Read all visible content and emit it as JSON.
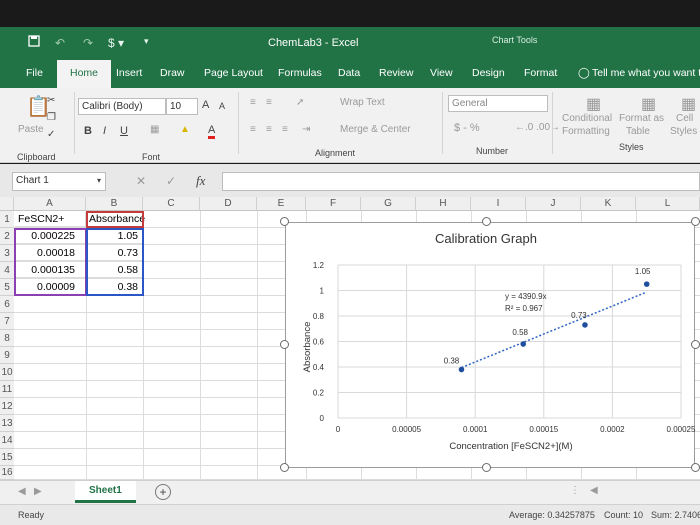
{
  "window": {
    "title": "ChemLab3 - Excel",
    "chart_tools": "Chart Tools"
  },
  "tabs": [
    "File",
    "Home",
    "Insert",
    "Draw",
    "Page Layout",
    "Formulas",
    "Data",
    "Review",
    "View",
    "Design",
    "Format"
  ],
  "active_tab": "Home",
  "tell_me": "Tell me what you want t",
  "ribbon": {
    "paste": "Paste",
    "clipboard": "Clipboard",
    "font_name": "Calibri (Body)",
    "font_size": "10",
    "font_group": "Font",
    "bold": "B",
    "italic": "I",
    "underline": "U",
    "wrap_text": "Wrap Text",
    "merge_center": "Merge & Center",
    "alignment_group": "Alignment",
    "number_format": "General",
    "number_symbols": "$ - %",
    "number_group": "Number",
    "conditional_1": "Conditional",
    "conditional_2": "Formatting",
    "format_as_1": "Format as",
    "format_as_2": "Table",
    "cell_1": "Cell",
    "cell_2": "Styles",
    "styles_group": "Styles"
  },
  "formula_bar": {
    "name_box": "Chart 1",
    "fx": "fx",
    "value": ""
  },
  "columns": [
    "A",
    "B",
    "C",
    "D",
    "E",
    "F",
    "G",
    "H",
    "I",
    "J",
    "K",
    "L"
  ],
  "rows": [
    "1",
    "2",
    "3",
    "4",
    "5",
    "6",
    "7",
    "8",
    "9",
    "10",
    "11",
    "12",
    "13",
    "14",
    "15",
    "16"
  ],
  "cells": {
    "A1": "FeSCN2+",
    "B1": "Absorbance",
    "A2": "0.000225",
    "B2": "1.05",
    "A3": "0.00018",
    "B3": "0.73",
    "A4": "0.000135",
    "B4": "0.58",
    "A5": "0.00009",
    "B5": "0.38"
  },
  "chart_data": {
    "type": "scatter",
    "title": "Calibration Graph",
    "xlabel": "Concentration [FeSCN2+](M)",
    "ylabel": "Absorbance",
    "x_ticks": [
      "0",
      "0.00005",
      "0.0001",
      "0.00015",
      "0.0002",
      "0.00025"
    ],
    "y_ticks": [
      "0",
      "0.2",
      "0.4",
      "0.6",
      "0.8",
      "1",
      "1.2"
    ],
    "xlim": [
      0,
      0.00025
    ],
    "ylim": [
      0,
      1.2
    ],
    "grid": true,
    "points": [
      {
        "x": 9e-05,
        "y": 0.38,
        "label": "0.38"
      },
      {
        "x": 0.000135,
        "y": 0.58,
        "label": "0.58"
      },
      {
        "x": 0.00018,
        "y": 0.73,
        "label": "0.73"
      },
      {
        "x": 0.000225,
        "y": 1.05,
        "label": "1.05"
      }
    ],
    "trendline": {
      "slope": 4390.9,
      "intercept": 0,
      "equation": "y = 4390.9x",
      "r2": "R² = 0.967"
    },
    "colors": {
      "marker": "#1f4e9e",
      "trend": "#2e63c0"
    }
  },
  "sheet": {
    "name": "Sheet1",
    "add": "+"
  },
  "status": {
    "ready": "Ready",
    "average": "Average: 0.34257875",
    "count": "Count: 10",
    "sum": "Sum: 2.7406"
  },
  "colors": {
    "excel_green": "#217346"
  }
}
